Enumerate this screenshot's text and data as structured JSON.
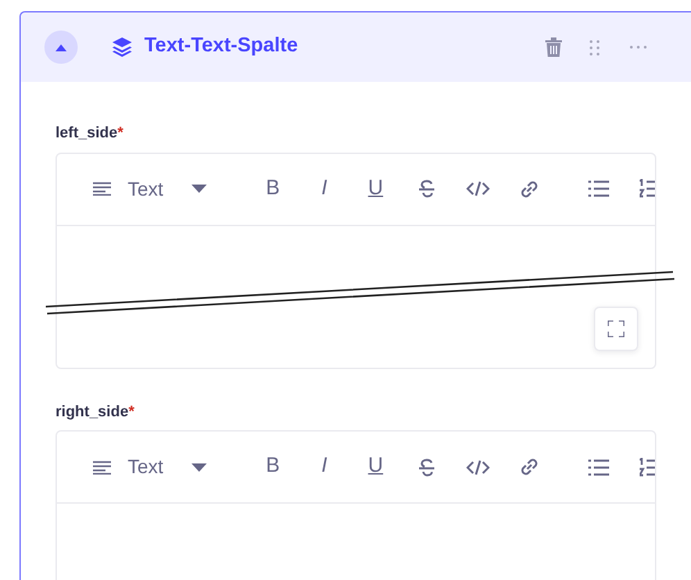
{
  "block": {
    "title": "Text-Text-Spalte",
    "expanded": true
  },
  "fields": [
    {
      "label": "left_side",
      "required_mark": "*",
      "format": "Text",
      "expand_button": true,
      "tools": [
        {
          "kind": "bold",
          "glyph": "B"
        },
        {
          "kind": "italic",
          "glyph": "I"
        },
        {
          "kind": "underline",
          "glyph": "U"
        },
        {
          "kind": "strike"
        },
        {
          "kind": "code"
        },
        {
          "kind": "link"
        },
        {
          "kind": "bullets"
        },
        {
          "kind": "numbers"
        }
      ]
    },
    {
      "label": "right_side",
      "required_mark": "*",
      "format": "Text",
      "tools": [
        {
          "kind": "bold",
          "glyph": "B"
        },
        {
          "kind": "italic",
          "glyph": "I"
        },
        {
          "kind": "underline",
          "glyph": "U"
        },
        {
          "kind": "strike"
        },
        {
          "kind": "code"
        },
        {
          "kind": "link"
        },
        {
          "kind": "bullets"
        },
        {
          "kind": "numbers"
        }
      ]
    }
  ]
}
